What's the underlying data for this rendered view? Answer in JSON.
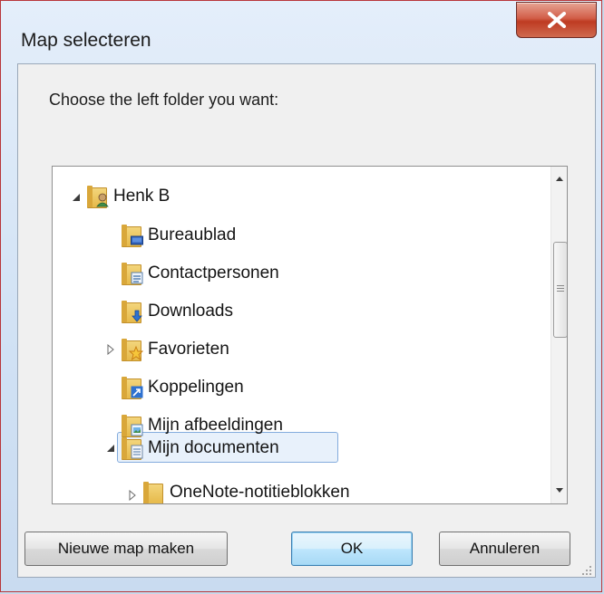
{
  "window": {
    "title": "Map selecteren",
    "close_icon": "close-x-icon"
  },
  "dialog": {
    "prompt": "Choose the left folder you want:"
  },
  "tree": {
    "items": [
      {
        "label": "Henk B",
        "level": 0,
        "expander": "expanded",
        "icon": "user-folder-icon"
      },
      {
        "label": "Bureaublad",
        "level": 1,
        "expander": "none",
        "icon": "desktop-folder-icon"
      },
      {
        "label": "Contactpersonen",
        "level": 1,
        "expander": "none",
        "icon": "contacts-folder-icon"
      },
      {
        "label": "Downloads",
        "level": 1,
        "expander": "none",
        "icon": "downloads-folder-icon"
      },
      {
        "label": "Favorieten",
        "level": 1,
        "expander": "collapsed",
        "icon": "favorites-folder-icon"
      },
      {
        "label": "Koppelingen",
        "level": 1,
        "expander": "none",
        "icon": "links-folder-icon"
      },
      {
        "label": "Mijn afbeeldingen",
        "level": 1,
        "expander": "none",
        "icon": "pictures-folder-icon"
      },
      {
        "label": "Mijn documenten",
        "level": 1,
        "expander": "expanded",
        "icon": "documents-folder-icon",
        "selected": true
      },
      {
        "label": "OneNote-notitieblokken",
        "level": 2,
        "expander": "collapsed",
        "icon": "folder-icon"
      }
    ]
  },
  "buttons": {
    "new_folder": "Nieuwe map maken",
    "ok": "OK",
    "cancel": "Annuleren"
  },
  "colors": {
    "selection_border": "#84acdd",
    "selection_fill": "#e8f1fb",
    "close_button": "#c9452c",
    "default_button_border": "#3c7fb1"
  }
}
